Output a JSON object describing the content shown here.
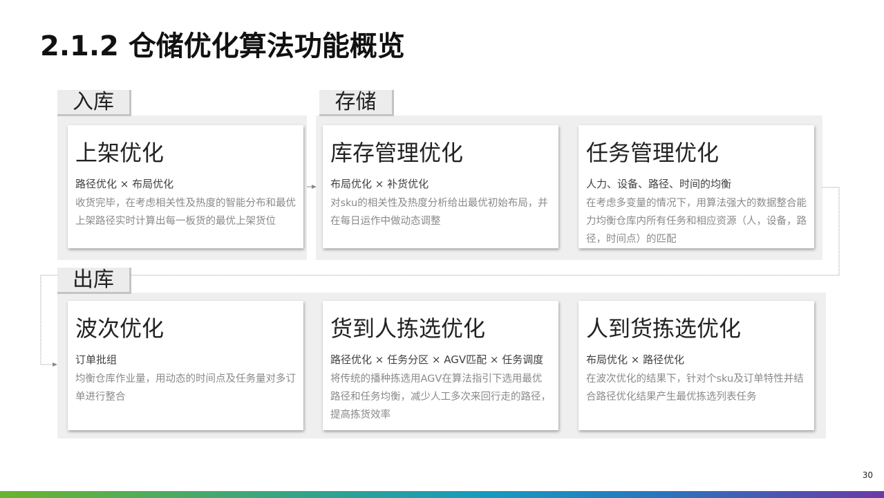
{
  "title": "2.1.2 仓储优化算法功能概览",
  "page_number": "30",
  "sections": {
    "inbound": "入库",
    "storage": "存储",
    "outbound": "出库"
  },
  "cards": [
    {
      "title": "上架优化",
      "subtitle": "路径优化 × 布局优化",
      "description": "收货完毕，在考虑相关性及热度的智能分布和最优上架路径实时计算出每一板货的最优上架货位"
    },
    {
      "title": "库存管理优化",
      "subtitle": "布局优化 × 补货优化",
      "description": "对sku的相关性及热度分析给出最优初始布局，并在每日运作中做动态调整"
    },
    {
      "title": "任务管理优化",
      "subtitle": "人力、设备、路径、时间的均衡",
      "description": "在考虑多变量的情况下，用算法强大的数据整合能力均衡仓库内所有任务和相应资源（人，设备，路径，时间点）的匹配"
    },
    {
      "title": "波次优化",
      "subtitle": "订单批组",
      "description": "均衡仓库作业量，用动态的时间点及任务量对多订单进行整合"
    },
    {
      "title": "货到人拣选优化",
      "subtitle": "路径优化 × 任务分区 × AGV匹配 × 任务调度",
      "description": "将传统的播种拣选用AGV在算法指引下选用最优路径和任务均衡，减少人工多次来回行走的路径，提高拣货效率"
    },
    {
      "title": "人到货拣选优化",
      "subtitle": "布局优化 × 路径优化",
      "description": "在波次优化的结果下，针对个sku及订单特性并结合路径优化结果产生最优拣选列表任务"
    }
  ]
}
